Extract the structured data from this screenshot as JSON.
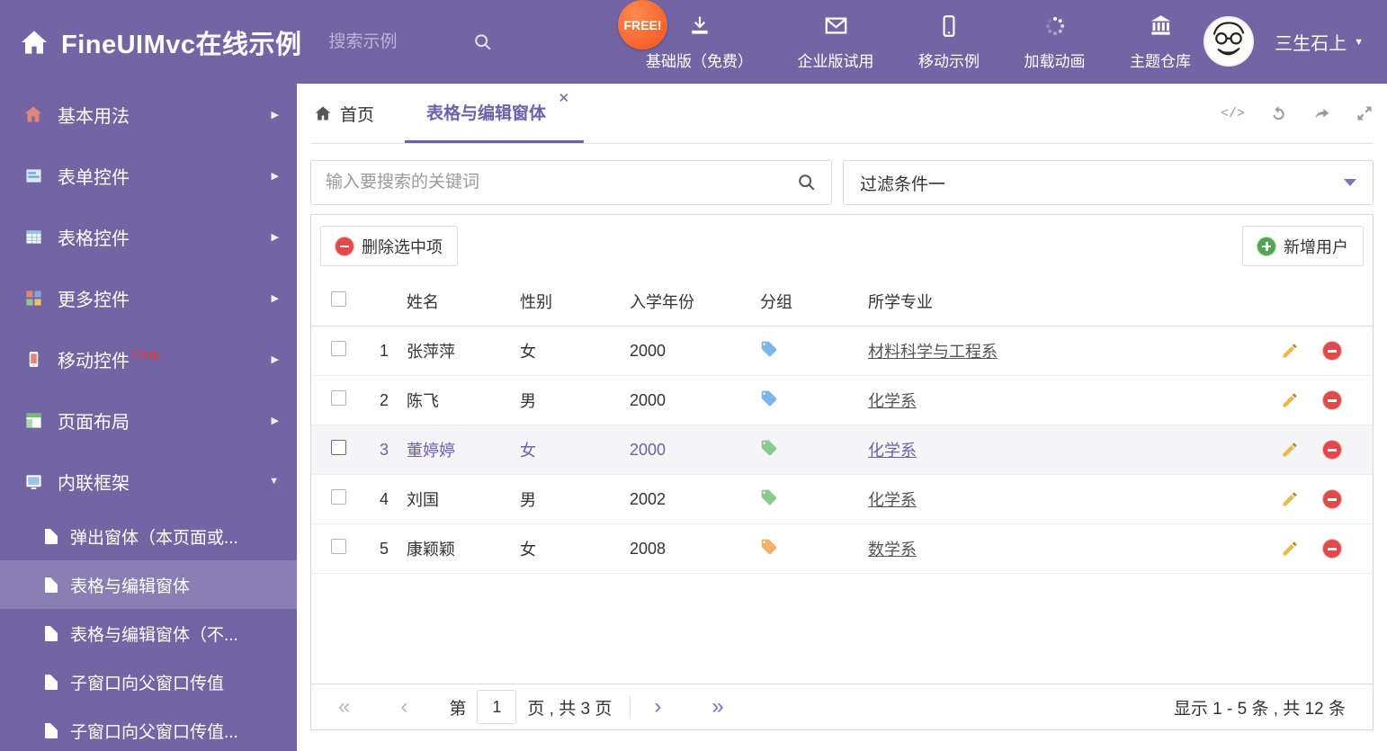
{
  "header": {
    "title": "FineUIMvc在线示例",
    "search_placeholder": "搜索示例",
    "free_badge": "FREE!",
    "nav": [
      {
        "label": "基础版（免费）"
      },
      {
        "label": "企业版试用"
      },
      {
        "label": "移动示例"
      },
      {
        "label": "加载动画"
      },
      {
        "label": "主题仓库"
      }
    ],
    "user_name": "三生石上"
  },
  "sidebar": {
    "items": [
      {
        "label": "基本用法"
      },
      {
        "label": "表单控件"
      },
      {
        "label": "表格控件"
      },
      {
        "label": "更多控件"
      },
      {
        "label": "移动控件",
        "badge": "Corp."
      },
      {
        "label": "页面布局"
      },
      {
        "label": "内联框架"
      }
    ],
    "subitems": [
      {
        "label": "弹出窗体（本页面或..."
      },
      {
        "label": "表格与编辑窗体"
      },
      {
        "label": "表格与编辑窗体（不..."
      },
      {
        "label": "子窗口向父窗口传值"
      },
      {
        "label": "子窗口向父窗口传值..."
      }
    ]
  },
  "tabs": {
    "home_label": "首页",
    "active_label": "表格与编辑窗体",
    "close_glyph": "✕"
  },
  "filter": {
    "search_placeholder": "输入要搜索的关键词",
    "dropdown_value": "过滤条件一"
  },
  "toolbar": {
    "delete_label": "删除选中项",
    "add_label": "新增用户"
  },
  "table": {
    "columns": [
      "姓名",
      "性别",
      "入学年份",
      "分组",
      "所学专业"
    ],
    "rows": [
      {
        "num": "1",
        "name": "张萍萍",
        "gender": "女",
        "year": "2000",
        "tag": "blue",
        "major": "材料科学与工程系",
        "selected": false
      },
      {
        "num": "2",
        "name": "陈飞",
        "gender": "男",
        "year": "2000",
        "tag": "blue",
        "major": "化学系",
        "selected": false
      },
      {
        "num": "3",
        "name": "董婷婷",
        "gender": "女",
        "year": "2000",
        "tag": "green",
        "major": "化学系",
        "selected": true
      },
      {
        "num": "4",
        "name": "刘国",
        "gender": "男",
        "year": "2002",
        "tag": "green",
        "major": "化学系",
        "selected": false
      },
      {
        "num": "5",
        "name": "康颖颖",
        "gender": "女",
        "year": "2008",
        "tag": "orange",
        "major": "数学系",
        "selected": false
      }
    ]
  },
  "pagination": {
    "page_prefix": "第",
    "current_page": "1",
    "page_suffix": "页 , 共 3 页",
    "summary": "显示 1 - 5 条 , 共 12 条"
  },
  "colors": {
    "purple": "#7365a4",
    "accent": "#6f61a9",
    "free_badge": "#ff5b2e",
    "delete_red": "#e04a4a",
    "add_green": "#52a552",
    "tags": {
      "blue": "#7ab7e8",
      "green": "#8cc98c",
      "orange": "#f2b267"
    }
  }
}
